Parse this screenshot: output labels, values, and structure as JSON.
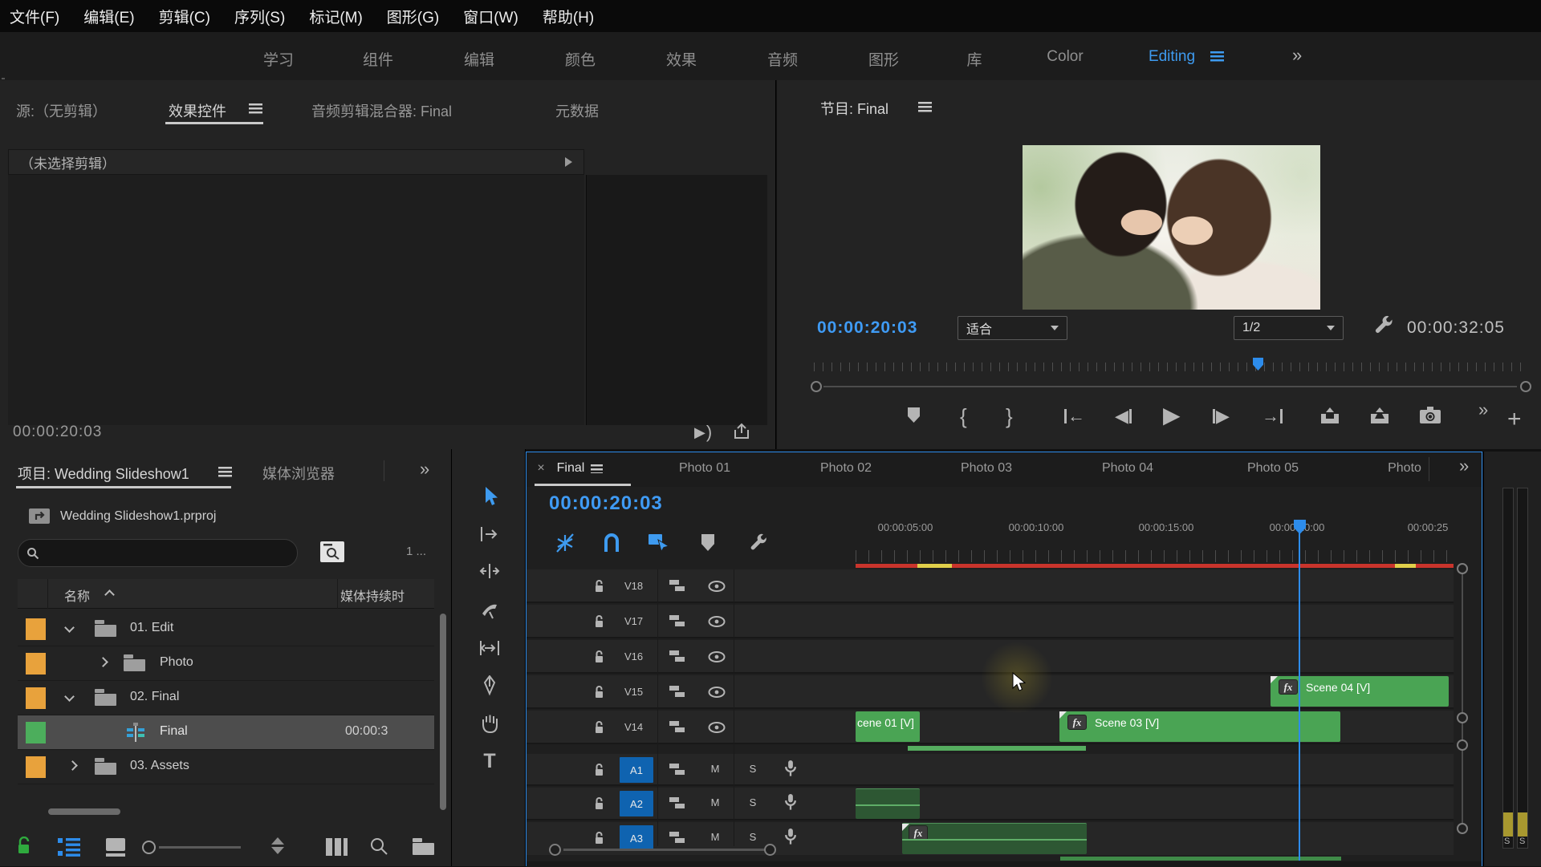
{
  "menu": {
    "items": [
      "文件(F)",
      "编辑(E)",
      "剪辑(C)",
      "序列(S)",
      "标记(M)",
      "图形(G)",
      "窗口(W)",
      "帮助(H)"
    ]
  },
  "workspace": {
    "tabs": [
      "学习",
      "组件",
      "编辑",
      "颜色",
      "效果",
      "音频",
      "图形",
      "库",
      "Color",
      "Editing"
    ],
    "active_tab": "Editing"
  },
  "icons": {
    "overflow": "»",
    "close": "×",
    "play": "▶",
    "step_back": "◀",
    "step_forward": "▶",
    "mark_in": "{",
    "mark_out": "}",
    "arrow_left": "←",
    "arrow_right": "→",
    "play_around_play": "▶",
    "play_around_arc": ")"
  },
  "source_panel": {
    "tab_source": "源:（无剪辑）",
    "tab_effect_controls": "效果控件",
    "tab_audio_mixer": "音频剪辑混合器: Final",
    "tab_metadata": "元数据",
    "no_clip_message": "（未选择剪辑）",
    "timecode": "00:00:20:03"
  },
  "program_panel": {
    "tab": "节目: Final",
    "timecode": "00:00:20:03",
    "zoom_level": "适合",
    "playback_resolution": "1/2",
    "duration": "00:00:32:05"
  },
  "project_panel": {
    "tab_project": "项目: Wedding Slideshow1",
    "tab_media_browser": "媒体浏览器",
    "filename": "Wedding Slideshow1.prproj",
    "item_count": "1 ...",
    "col_name": "名称",
    "col_media_duration": "媒体持续时",
    "rows": [
      {
        "name": "01. Edit"
      },
      {
        "name": "Photo"
      },
      {
        "name": "02. Final"
      },
      {
        "name": "Final",
        "duration": "00:00:3"
      },
      {
        "name": "03. Assets"
      }
    ]
  },
  "timeline": {
    "active_tab": "Final",
    "tabs": [
      "Photo 01",
      "Photo 02",
      "Photo 03",
      "Photo 04",
      "Photo 05",
      "Photo"
    ],
    "timecode": "00:00:20:03",
    "ruler_labels": [
      "00:00:05:00",
      "00:00:10:00",
      "00:00:15:00",
      "00:00:20:00",
      "00:00:25"
    ],
    "video_tracks": [
      "V18",
      "V17",
      "V16",
      "V15",
      "V14"
    ],
    "audio_tracks": [
      "A1",
      "A2",
      "A3"
    ],
    "mute_label": "M",
    "solo_label": "S",
    "clip_scene01": "cene 01 [V]",
    "clip_scene03": "Scene 03 [V]",
    "clip_scene04": "Scene 04 [V]",
    "fx_badge": "fx"
  },
  "audio_meters": {
    "solo_left": "S",
    "solo_right": "S"
  },
  "colors": {
    "accent": "#2d8ceb",
    "timecode_blue": "#3f9bf5",
    "clip_green": "#4aa454",
    "audio_clip_green": "#2d5733",
    "bin_orange": "#e8a23c",
    "sequence_green": "#4cae5c",
    "render_red": "#c9342c",
    "render_yellow": "#e0cf4a"
  }
}
